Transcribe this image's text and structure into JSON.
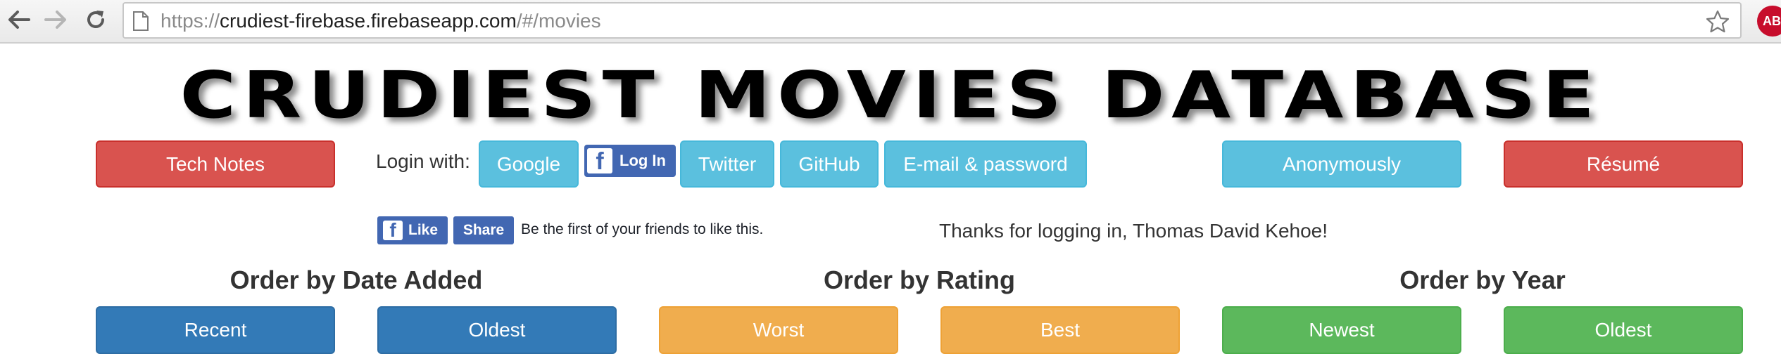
{
  "browser": {
    "url_scheme": "https://",
    "url_host": "crudiest-firebase.firebaseapp.com",
    "url_path": "/#/movies",
    "extension_badge": "ABP"
  },
  "site": {
    "title": "CRUDIEST MOVIES DATABASE"
  },
  "nav": {
    "tech_notes": "Tech Notes",
    "login_label": "Login with:",
    "google": "Google",
    "facebook_login": "Log In",
    "twitter": "Twitter",
    "github": "GitHub",
    "email_password": "E-mail & password",
    "anonymously": "Anonymously",
    "resume": "Résumé"
  },
  "social": {
    "like": "Like",
    "share": "Share",
    "friends_text": "Be the first of your friends to like this."
  },
  "status": {
    "welcome": "Thanks for logging in, Thomas David Kehoe!"
  },
  "sorting": {
    "date_heading": "Order by Date Added",
    "recent": "Recent",
    "oldest_added": "Oldest",
    "rating_heading": "Order by Rating",
    "worst": "Worst",
    "best": "Best",
    "year_heading": "Order by Year",
    "newest": "Newest",
    "oldest_year": "Oldest"
  },
  "colors": {
    "danger": "#d9534f",
    "info": "#5bc0de",
    "primary": "#337ab7",
    "warning": "#f0ad4e",
    "success": "#5cb85c",
    "facebook": "#4267b2"
  }
}
